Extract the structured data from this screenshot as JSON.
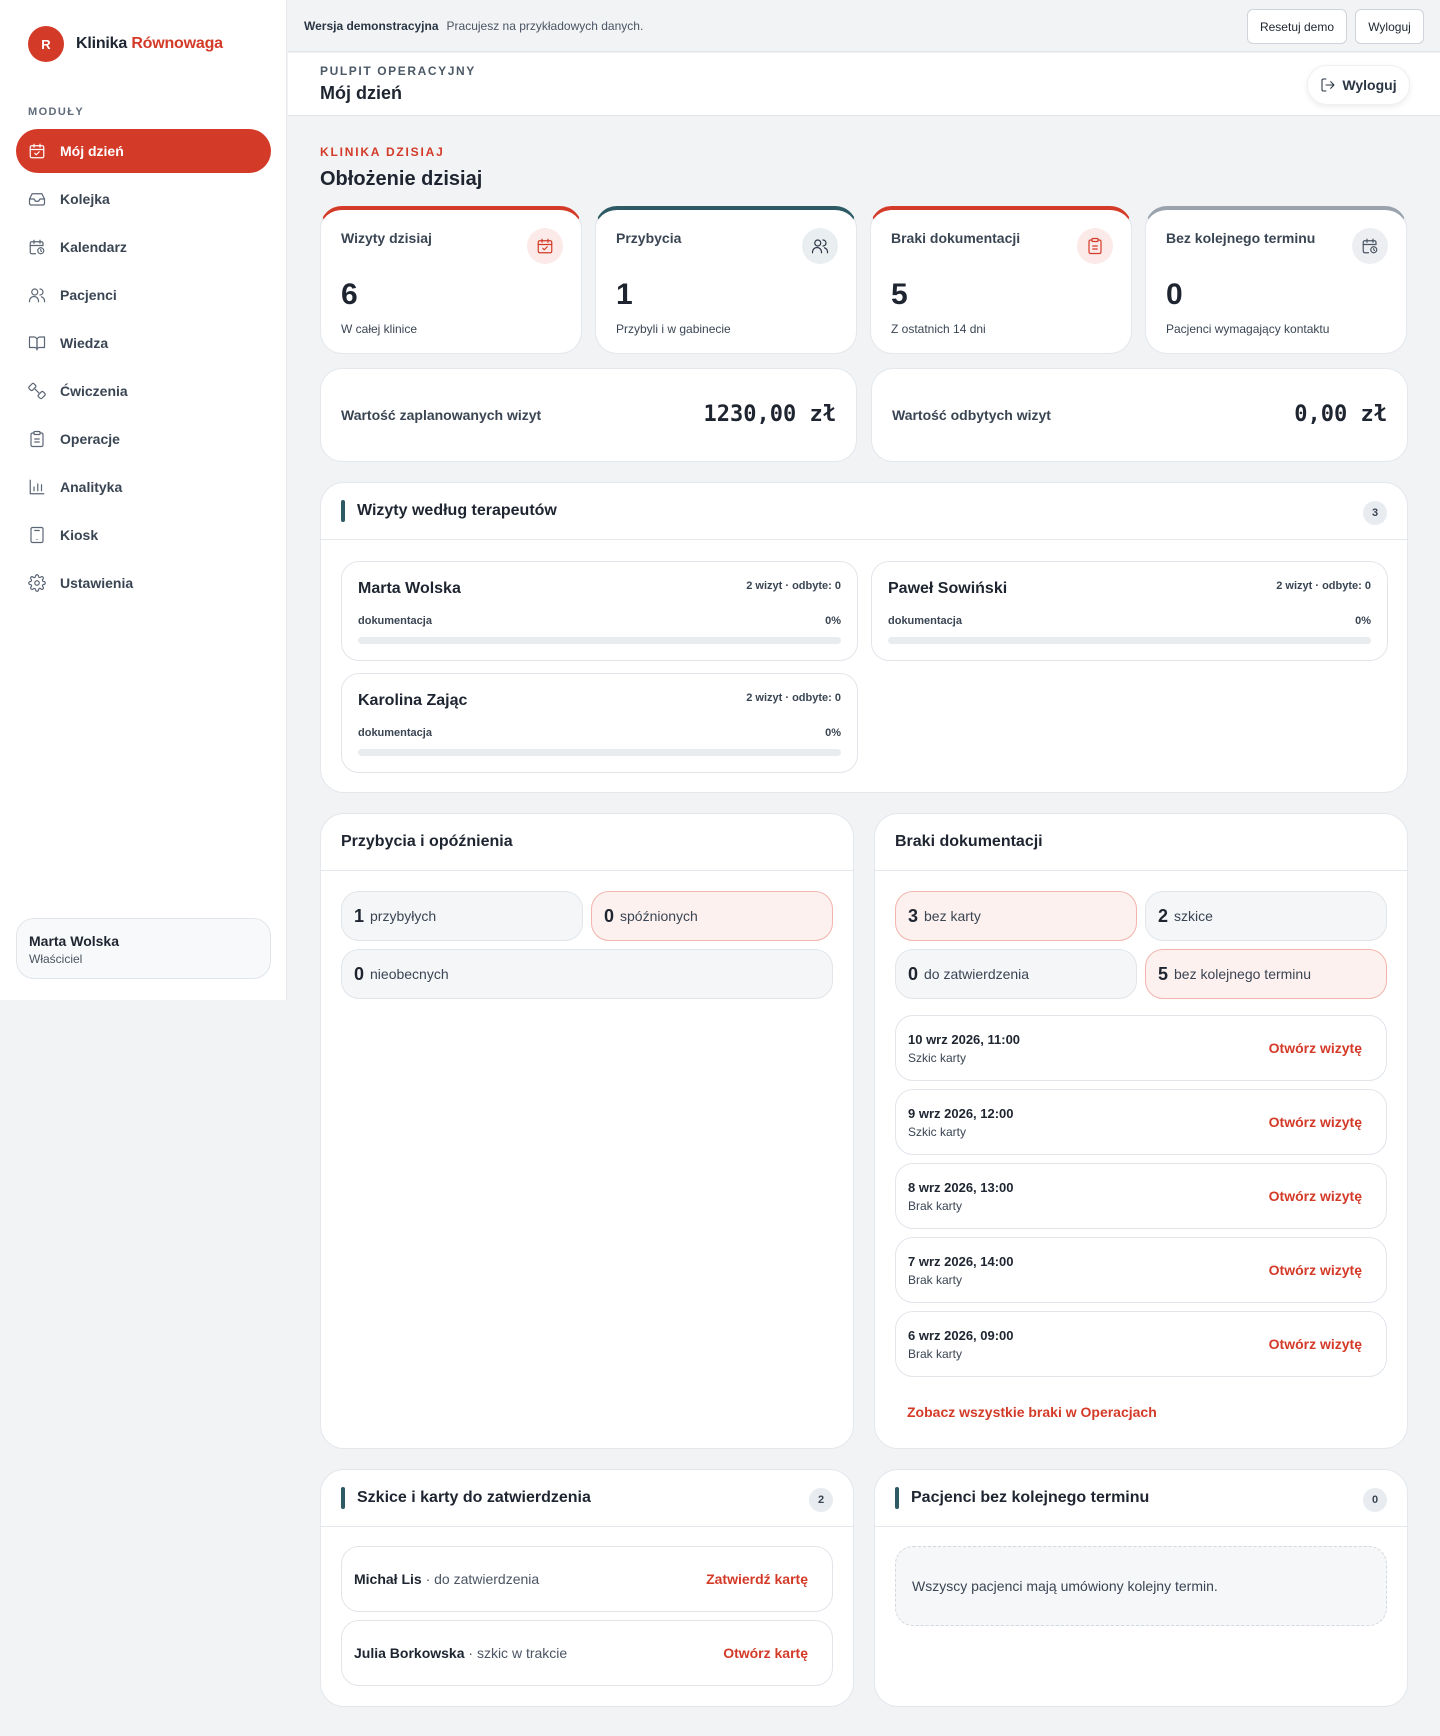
{
  "brand": {
    "logo_letter": "R",
    "name": "Klinika",
    "accent": "Równowaga",
    "accent_color": "#d43a28"
  },
  "sidebar": {
    "section_label": "MODUŁY",
    "items": [
      {
        "label": "Mój dzień",
        "icon": "calendar-check-icon",
        "active": true
      },
      {
        "label": "Kolejka",
        "icon": "inbox-icon"
      },
      {
        "label": "Kalendarz",
        "icon": "calendar-clock-icon"
      },
      {
        "label": "Pacjenci",
        "icon": "users-icon"
      },
      {
        "label": "Wiedza",
        "icon": "book-icon"
      },
      {
        "label": "Ćwiczenia",
        "icon": "dumbbell-icon"
      },
      {
        "label": "Operacje",
        "icon": "clipboard-icon"
      },
      {
        "label": "Analityka",
        "icon": "bar-chart-icon"
      },
      {
        "label": "Kiosk",
        "icon": "tablet-icon"
      },
      {
        "label": "Ustawienia",
        "icon": "gear-icon"
      }
    ],
    "user": {
      "name": "Marta Wolska",
      "role": "Właściciel"
    }
  },
  "topbar": {
    "demo_title": "Wersja demonstracyjna",
    "demo_text": "Pracujesz na przykładowych danych.",
    "reset_label": "Resetuj demo",
    "logout_label": "Wyloguj"
  },
  "header": {
    "eyebrow": "PULPIT OPERACYJNY",
    "title": "Mój dzień",
    "logout_label": "Wyloguj"
  },
  "main": {
    "eyebrow": "KLINIKA DZISIAJ",
    "title": "Obłożenie dzisiaj",
    "stats": [
      {
        "label": "Wizyty dzisiaj",
        "value": "6",
        "sub": "W całej klinice",
        "icon": "calendar-check-icon",
        "color": "#d43a28"
      },
      {
        "label": "Przybycia",
        "value": "1",
        "sub": "Przybyli i w gabinecie",
        "icon": "users-icon",
        "color": "#2d5a64"
      },
      {
        "label": "Braki dokumentacji",
        "value": "5",
        "sub": "Z ostatnich 14 dni",
        "icon": "clipboard-icon",
        "color": "#d43a28"
      },
      {
        "label": "Bez kolejnego terminu",
        "value": "0",
        "sub": "Pacjenci wymagający kontaktu",
        "icon": "calendar-clock-icon",
        "color": "#9aa3ad"
      }
    ],
    "values": [
      {
        "label": "Wartość zaplanowanych wizyt",
        "amount": "1230,00 zł"
      },
      {
        "label": "Wartość odbytych wizyt",
        "amount": "0,00 zł"
      }
    ]
  },
  "therapists_panel": {
    "title": "Wizyty według terapeutów",
    "count": "3",
    "doc_label": "dokumentacja",
    "items": [
      {
        "name": "Marta Wolska",
        "visits": "2 wizyt · odbyte: 0",
        "pct": "0%",
        "progress": 0
      },
      {
        "name": "Paweł Sowiński",
        "visits": "2 wizyt · odbyte: 0",
        "pct": "0%",
        "progress": 0
      },
      {
        "name": "Karolina Zając",
        "visits": "2 wizyt · odbyte: 0",
        "pct": "0%",
        "progress": 0
      }
    ]
  },
  "arrivals_panel": {
    "title": "Przybycia i opóźnienia",
    "pills": [
      {
        "num": "1",
        "text": "przybyłych"
      },
      {
        "num": "0",
        "text": "spóźnionych",
        "alert": true
      },
      {
        "num": "0",
        "text": "nieobecnych"
      }
    ]
  },
  "docs_panel": {
    "title": "Braki dokumentacji",
    "pills": [
      {
        "num": "3",
        "text": "bez karty",
        "alert": true
      },
      {
        "num": "2",
        "text": "szkice"
      },
      {
        "num": "0",
        "text": "do zatwierdzenia"
      },
      {
        "num": "5",
        "text": "bez kolejnego terminu",
        "alert": true
      }
    ],
    "items": [
      {
        "date": "10 wrz 2026, 11:00",
        "status": "Szkic karty",
        "action": "Otwórz wizytę"
      },
      {
        "date": "9 wrz 2026, 12:00",
        "status": "Szkic karty",
        "action": "Otwórz wizytę"
      },
      {
        "date": "8 wrz 2026, 13:00",
        "status": "Brak karty",
        "action": "Otwórz wizytę"
      },
      {
        "date": "7 wrz 2026, 14:00",
        "status": "Brak karty",
        "action": "Otwórz wizytę"
      },
      {
        "date": "6 wrz 2026, 09:00",
        "status": "Brak karty",
        "action": "Otwórz wizytę"
      }
    ],
    "see_all": "Zobacz wszystkie braki w Operacjach"
  },
  "drafts_panel": {
    "title": "Szkice i karty do zatwierdzenia",
    "count": "2",
    "items": [
      {
        "name": "Michał Lis",
        "status": " · do zatwierdzenia",
        "action": "Zatwierdź kartę"
      },
      {
        "name": "Julia Borkowska",
        "status": " · szkic w trakcie",
        "action": "Otwórz kartę"
      }
    ]
  },
  "no_next_panel": {
    "title": "Pacjenci bez kolejnego terminu",
    "count": "0",
    "empty_text": "Wszyscy pacjenci mają umówiony kolejny termin."
  }
}
